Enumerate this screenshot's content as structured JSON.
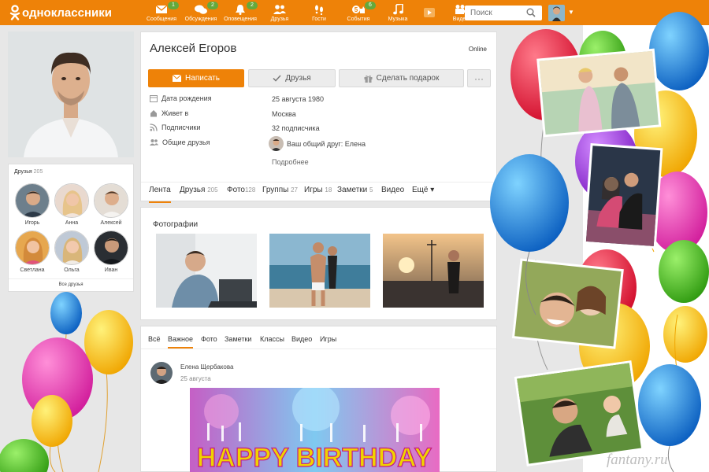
{
  "header": {
    "logo": "одноклассники",
    "nav": [
      {
        "label": "Сообщения",
        "icon": "envelope-icon",
        "badge": "1"
      },
      {
        "label": "Обсуждения",
        "icon": "chat-bubbles-icon",
        "badge": "2"
      },
      {
        "label": "Оповещения",
        "icon": "bell-icon",
        "badge": "2"
      },
      {
        "label": "Друзья",
        "icon": "people-icon",
        "badge": ""
      },
      {
        "label": "Гости",
        "icon": "footprints-icon",
        "badge": ""
      },
      {
        "label": "События",
        "icon": "events-icon",
        "badge": "6",
        "count": "5"
      },
      {
        "label": "Музыка",
        "icon": "music-note-icon",
        "badge": ""
      },
      {
        "label": "",
        "icon": "video-play-icon",
        "badge": ""
      },
      {
        "label": "Видео",
        "icon": "video-camera-icon",
        "badge": ""
      }
    ],
    "search_placeholder": "Поиск"
  },
  "profile": {
    "name": "Алексей Егоров",
    "status": "Online",
    "actions": {
      "write": "Написать",
      "friends": "Друзья",
      "gift": "Сделать подарок",
      "more": "···"
    },
    "info": [
      {
        "label": "Дата рождения",
        "value": "25 августа 1980",
        "icon": "calendar-icon"
      },
      {
        "label": "Живет в",
        "value": "Москва",
        "icon": "house-icon"
      },
      {
        "label": "Подписчики",
        "value": "32 подписчика",
        "icon": "rss-icon"
      },
      {
        "label": "Общие друзья",
        "value": "Ваш общий друг: Елена",
        "icon": "people-icon"
      }
    ],
    "more_link": "Подробнее",
    "tabs": [
      {
        "label": "Лента",
        "count": ""
      },
      {
        "label": "Друзья",
        "count": "205"
      },
      {
        "label": "Фото",
        "count": "128"
      },
      {
        "label": "Группы",
        "count": "27"
      },
      {
        "label": "Игры",
        "count": "18"
      },
      {
        "label": "Заметки",
        "count": "5"
      },
      {
        "label": "Видео",
        "count": ""
      },
      {
        "label": "Ещё ▾",
        "count": ""
      }
    ]
  },
  "friends_widget": {
    "title": "Друзья",
    "count": "205",
    "friends": [
      "Игорь",
      "Анна",
      "Алексей",
      "Светлана",
      "Ольга",
      "Иван"
    ],
    "all_link": "Все друзья"
  },
  "photos": {
    "title": "Фотографии"
  },
  "feed": {
    "tabs": [
      "Всё",
      "Важное",
      "Фото",
      "Заметки",
      "Классы",
      "Видео",
      "Игры"
    ],
    "active_tab": "Важное",
    "post": {
      "author": "Елена Щербакова",
      "date": "25 августа",
      "image_text": "HAPPY BIRTHDAY"
    }
  },
  "watermark": "fantany.ru",
  "colors": {
    "accent": "#ee8208",
    "badge": "#64a93c",
    "page_bg": "#e7e7e7"
  }
}
